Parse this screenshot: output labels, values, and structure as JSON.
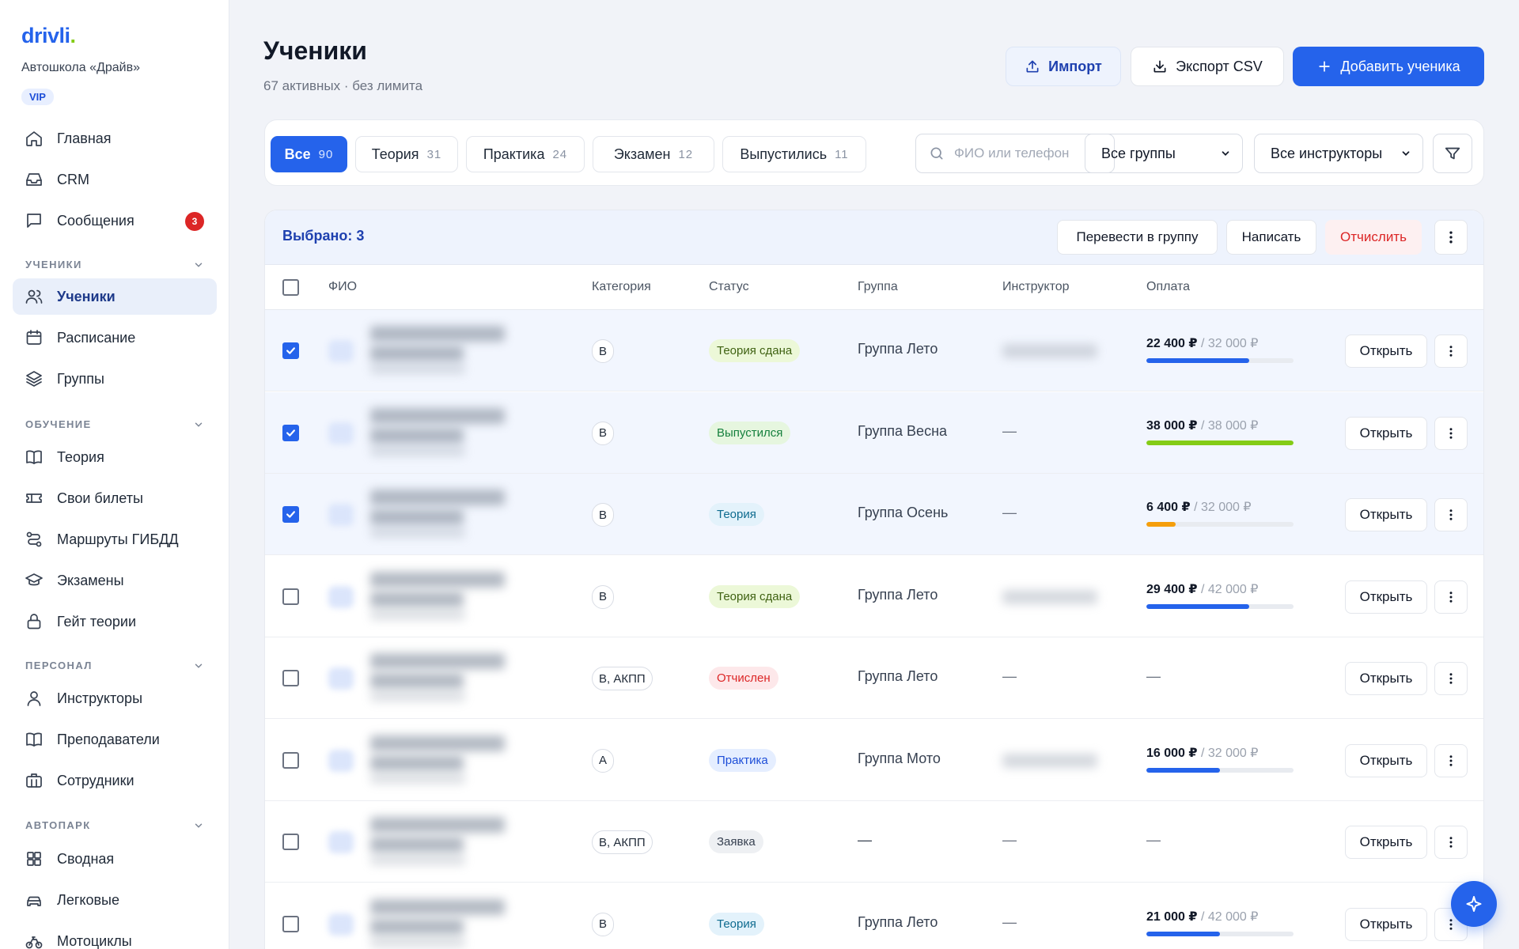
{
  "brand": {
    "logo_text": "drivli",
    "logo_dot": ".",
    "school_name": "Автошкола «Драйв»",
    "plan_badge": "VIP"
  },
  "sidebar": {
    "top_items": [
      {
        "label": "Главная",
        "icon": "home-icon"
      },
      {
        "label": "CRM",
        "icon": "inbox-icon"
      },
      {
        "label": "Сообщения",
        "icon": "message-icon",
        "badge": "3"
      }
    ],
    "sections": [
      {
        "title": "УЧЕНИКИ",
        "items": [
          {
            "label": "Ученики",
            "icon": "users-icon",
            "active": true
          },
          {
            "label": "Расписание",
            "icon": "calendar-icon"
          },
          {
            "label": "Группы",
            "icon": "layers-icon"
          }
        ]
      },
      {
        "title": "ОБУЧЕНИЕ",
        "items": [
          {
            "label": "Теория",
            "icon": "book-icon"
          },
          {
            "label": "Свои билеты",
            "icon": "ticket-icon"
          },
          {
            "label": "Маршруты ГИБДД",
            "icon": "route-icon"
          },
          {
            "label": "Экзамены",
            "icon": "graduation-icon"
          },
          {
            "label": "Гейт теории",
            "icon": "lock-icon"
          }
        ]
      },
      {
        "title": "ПЕРСОНАЛ",
        "items": [
          {
            "label": "Инструкторы",
            "icon": "user-icon"
          },
          {
            "label": "Преподаватели",
            "icon": "book-icon"
          },
          {
            "label": "Сотрудники",
            "icon": "briefcase-icon"
          }
        ]
      },
      {
        "title": "АВТОПАРК",
        "items": [
          {
            "label": "Сводная",
            "icon": "grid-icon"
          },
          {
            "label": "Легковые",
            "icon": "car-icon"
          },
          {
            "label": "Мотоциклы",
            "icon": "bike-icon"
          }
        ]
      }
    ]
  },
  "header": {
    "title": "Ученики",
    "subtitle": "67 активных · без лимита",
    "import_label": "Импорт",
    "export_label": "Экспорт CSV",
    "add_label": "Добавить ученика"
  },
  "filters": {
    "chips": [
      {
        "label": "Все",
        "count": "90",
        "active": true
      },
      {
        "label": "Теория",
        "count": "31"
      },
      {
        "label": "Практика",
        "count": "24"
      },
      {
        "label": "Экзамен",
        "count": "12"
      },
      {
        "label": "Выпустились",
        "count": "11"
      }
    ],
    "search_placeholder": "ФИО или телефон",
    "group_select": "Все группы",
    "instructor_select": "Все инструкторы"
  },
  "selection": {
    "text": "Выбрано: 3",
    "move_label": "Перевести в группу",
    "write_label": "Написать",
    "expel_label": "Отчислить"
  },
  "table": {
    "columns": {
      "name": "ФИО",
      "category": "Категория",
      "status": "Статус",
      "group": "Группа",
      "instructor": "Инструктор",
      "payment": "Оплата"
    },
    "open_label": "Открыть",
    "rows": [
      {
        "checked": true,
        "category": "B",
        "status": "Теория сдана",
        "status_kind": "passed",
        "group": "Группа Лето",
        "instructor_blurred": true,
        "paid": "22 400 ₽",
        "total": "32 000 ₽",
        "progress": 0.7,
        "bar_color": "#2563eb"
      },
      {
        "checked": true,
        "category": "B",
        "status": "Выпустился",
        "status_kind": "graduated",
        "group": "Группа Весна",
        "instructor": "—",
        "paid": "38 000 ₽",
        "total": "38 000 ₽",
        "progress": 1.0,
        "bar_color": "#84cc16"
      },
      {
        "checked": true,
        "category": "B",
        "status": "Теория",
        "status_kind": "theory",
        "group": "Группа Осень",
        "instructor": "—",
        "paid": "6 400 ₽",
        "total": "32 000 ₽",
        "progress": 0.2,
        "bar_color": "#f59e0b"
      },
      {
        "checked": false,
        "category": "B",
        "status": "Теория сдана",
        "status_kind": "passed",
        "group": "Группа Лето",
        "instructor_blurred": true,
        "paid": "29 400 ₽",
        "total": "42 000 ₽",
        "progress": 0.7,
        "bar_color": "#2563eb"
      },
      {
        "checked": false,
        "category": "B, АКПП",
        "status": "Отчислен",
        "status_kind": "expelled",
        "group": "Группа Лето",
        "instructor": "—",
        "payment_dash": "—"
      },
      {
        "checked": false,
        "category": "A",
        "status": "Практика",
        "status_kind": "practice",
        "group": "Группа Мото",
        "instructor_blurred": true,
        "paid": "16 000 ₽",
        "total": "32 000 ₽",
        "progress": 0.5,
        "bar_color": "#2563eb"
      },
      {
        "checked": false,
        "category": "B, АКПП",
        "status": "Заявка",
        "status_kind": "request",
        "group": "—",
        "instructor": "—",
        "payment_dash": "—"
      },
      {
        "checked": false,
        "category": "B",
        "status": "Теория",
        "status_kind": "theory",
        "group": "Группа Лето",
        "instructor": "—",
        "paid": "21 000 ₽",
        "total": "42 000 ₽",
        "progress": 0.5,
        "bar_color": "#2563eb"
      }
    ]
  },
  "status_colors": {
    "passed": {
      "bg": "#ecf8d8",
      "fg": "#3f6212"
    },
    "graduated": {
      "bg": "#e6f6df",
      "fg": "#15803d"
    },
    "theory": {
      "bg": "#e3f2fb",
      "fg": "#0e6b8f"
    },
    "practice": {
      "bg": "#e5eeff",
      "fg": "#1d4ed8"
    },
    "expelled": {
      "bg": "#fde8ea",
      "fg": "#dc2626"
    },
    "request": {
      "bg": "#eef0f3",
      "fg": "#374151"
    }
  }
}
